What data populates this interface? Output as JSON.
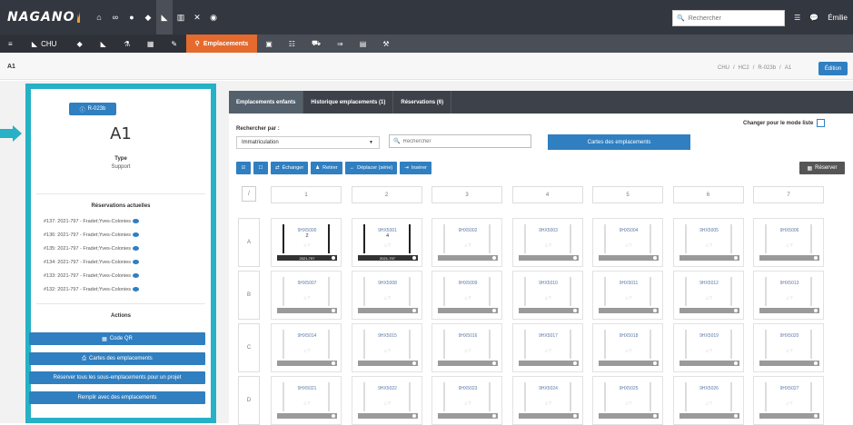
{
  "app": {
    "logo": "NAGANO",
    "search_placeholder": "Rechercher",
    "user": "Émilie"
  },
  "topbar": {
    "icons": [
      "home-icon",
      "infinity-icon",
      "flask-icon",
      "tint-icon",
      "microscope-icon",
      "barcode-icon",
      "tools-icon",
      "gauge-icon"
    ]
  },
  "subbar": {
    "items": [
      {
        "name": "menu-icon",
        "label": "≡"
      },
      {
        "name": "chu-item",
        "label": "CHU"
      },
      {
        "name": "tint-icon",
        "label": ""
      },
      {
        "name": "syringe-icon",
        "label": ""
      },
      {
        "name": "flask-icon",
        "label": ""
      },
      {
        "name": "calendar-icon",
        "label": ""
      },
      {
        "name": "pen-icon",
        "label": ""
      }
    ],
    "active_label": "Emplacements",
    "right_icons": [
      "table-icon",
      "list-icon",
      "cart-icon",
      "arrows-icon",
      "file-icon",
      "wrench-icon"
    ]
  },
  "page": {
    "title": "A1",
    "breadcrumb": [
      "CHU",
      "/",
      "HC2",
      "/",
      "R-023b",
      "/",
      "A1"
    ],
    "edit_label": "Édition"
  },
  "left": {
    "badge": "R-023b",
    "title": "A1",
    "type_label": "Type",
    "type_value": "Support",
    "reservations_title": "Réservations actuelles",
    "reservations": [
      "#137: 2021-797 - Fradet;Yves-Colonies",
      "#136: 2021-797 - Fradet;Yves-Colonies",
      "#135: 2021-797 - Fradet;Yves-Colonies",
      "#134: 2021-797 - Fradet;Yves-Colonies",
      "#133: 2021-797 - Fradet;Yves-Colonies",
      "#132: 2021-797 - Fradet;Yves-Colonies"
    ],
    "actions_title": "Actions",
    "actions": [
      "Code QR",
      "Cartes des emplacements",
      "Réserver tous les sous-emplacements pour un projet",
      "Remplir avec des emplacements"
    ]
  },
  "right": {
    "tabs": [
      "Emplacements enfants",
      "Historique emplacements (1)",
      "Réservations (6)"
    ],
    "search_by_label": "Rechercher par :",
    "search_by_value": "Immatriculation",
    "search_placeholder": "Rechercher",
    "cartes_label": "Cartes des emplacements",
    "mode_liste_label": "Changer pour le mode liste",
    "toolbar": [
      "Échanger",
      "Retirer",
      "Déplacer (série)",
      "Insérer"
    ],
    "reserver_label": "Réserver",
    "corner": "/",
    "columns": [
      "1",
      "2",
      "3",
      "4",
      "5",
      "6",
      "7"
    ],
    "rows": [
      {
        "label": "A",
        "cells": [
          {
            "name": "9HX5000",
            "num": "2",
            "foot": "2021-797",
            "filled": true
          },
          {
            "name": "9HX5001",
            "num": "4",
            "foot": "2021-797",
            "filled": true
          },
          {
            "name": "9HX5002",
            "num": "",
            "foot": "",
            "filled": false
          },
          {
            "name": "9HX5003",
            "num": "",
            "foot": "",
            "filled": false
          },
          {
            "name": "9HX5004",
            "num": "",
            "foot": "",
            "filled": false
          },
          {
            "name": "9HX5005",
            "num": "",
            "foot": "",
            "filled": false
          },
          {
            "name": "9HX5006",
            "num": "",
            "foot": "",
            "filled": false
          }
        ]
      },
      {
        "label": "B",
        "cells": [
          {
            "name": "9HX5007",
            "num": "",
            "foot": "",
            "filled": false
          },
          {
            "name": "9HX5008",
            "num": "",
            "foot": "",
            "filled": false
          },
          {
            "name": "9HX5009",
            "num": "",
            "foot": "",
            "filled": false
          },
          {
            "name": "9HX5010",
            "num": "",
            "foot": "",
            "filled": false
          },
          {
            "name": "9HX5011",
            "num": "",
            "foot": "",
            "filled": false
          },
          {
            "name": "9HX5012",
            "num": "",
            "foot": "",
            "filled": false
          },
          {
            "name": "9HX5013",
            "num": "",
            "foot": "",
            "filled": false
          }
        ]
      },
      {
        "label": "C",
        "cells": [
          {
            "name": "9HX5014",
            "num": "",
            "foot": "",
            "filled": false
          },
          {
            "name": "9HX5015",
            "num": "",
            "foot": "",
            "filled": false
          },
          {
            "name": "9HX5016",
            "num": "",
            "foot": "",
            "filled": false
          },
          {
            "name": "9HX5017",
            "num": "",
            "foot": "",
            "filled": false
          },
          {
            "name": "9HX5018",
            "num": "",
            "foot": "",
            "filled": false
          },
          {
            "name": "9HX5019",
            "num": "",
            "foot": "",
            "filled": false
          },
          {
            "name": "9HX5020",
            "num": "",
            "foot": "",
            "filled": false
          }
        ]
      },
      {
        "label": "D",
        "cells": [
          {
            "name": "9HX5021",
            "num": "",
            "foot": "",
            "filled": false
          },
          {
            "name": "9HX5022",
            "num": "",
            "foot": "",
            "filled": false
          },
          {
            "name": "9HX5023",
            "num": "",
            "foot": "",
            "filled": false
          },
          {
            "name": "9HX5024",
            "num": "",
            "foot": "",
            "filled": false
          },
          {
            "name": "9HX5025",
            "num": "",
            "foot": "",
            "filled": false
          },
          {
            "name": "9HX5026",
            "num": "",
            "foot": "",
            "filled": false
          },
          {
            "name": "9HX5027",
            "num": "",
            "foot": "",
            "filled": false
          }
        ]
      }
    ]
  },
  "colors": {
    "accent": "#2f7fc1",
    "highlight": "#26b1c6",
    "active_tab": "#e46a2e",
    "topbar": "#33373f"
  }
}
